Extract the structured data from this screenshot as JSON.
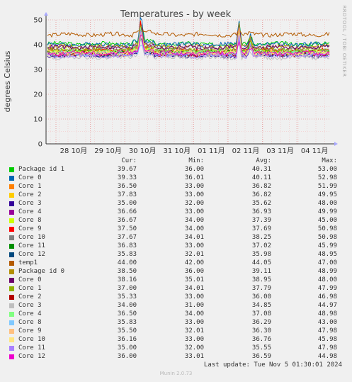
{
  "chart_data": {
    "type": "line",
    "title": "Temperatures - by week",
    "ylabel": "degrees Celsius",
    "side_label": "RRDTOOL / TOBI OETIKER",
    "ylim": [
      0,
      50
    ],
    "yticks": [
      0,
      10,
      20,
      30,
      40,
      50
    ],
    "xticks": [
      "28 10月",
      "29 10月",
      "30 10月",
      "31 10月",
      "01 11月",
      "02 11月",
      "03 11月",
      "04 11月"
    ],
    "grid": true,
    "columns": [
      "Cur:",
      "Min:",
      "Avg:",
      "Max:"
    ],
    "series": [
      {
        "name": "Package id 1",
        "color": "#00cc00",
        "cur": "39.67",
        "min": "36.00",
        "avg": "40.31",
        "max": "53.00"
      },
      {
        "name": "Core 0",
        "color": "#0066b3",
        "cur": "39.33",
        "min": "36.01",
        "avg": "40.11",
        "max": "52.98"
      },
      {
        "name": "Core 1",
        "color": "#ff8000",
        "cur": "36.50",
        "min": "33.00",
        "avg": "36.82",
        "max": "51.99"
      },
      {
        "name": "Core 2",
        "color": "#ffcc00",
        "cur": "37.83",
        "min": "33.00",
        "avg": "36.82",
        "max": "49.95"
      },
      {
        "name": "Core 3",
        "color": "#330099",
        "cur": "35.00",
        "min": "32.00",
        "avg": "35.62",
        "max": "48.00"
      },
      {
        "name": "Core 4",
        "color": "#990099",
        "cur": "36.66",
        "min": "33.00",
        "avg": "36.93",
        "max": "49.99"
      },
      {
        "name": "Core 8",
        "color": "#ccff00",
        "cur": "36.67",
        "min": "34.00",
        "avg": "37.39",
        "max": "45.00"
      },
      {
        "name": "Core 9",
        "color": "#ff0000",
        "cur": "37.50",
        "min": "34.00",
        "avg": "37.69",
        "max": "50.98"
      },
      {
        "name": "Core 10",
        "color": "#808080",
        "cur": "37.67",
        "min": "34.01",
        "avg": "38.25",
        "max": "50.98"
      },
      {
        "name": "Core 11",
        "color": "#008f00",
        "cur": "36.83",
        "min": "33.00",
        "avg": "37.02",
        "max": "45.99"
      },
      {
        "name": "Core 12",
        "color": "#00487d",
        "cur": "35.83",
        "min": "32.01",
        "avg": "35.98",
        "max": "48.95"
      },
      {
        "name": "temp1",
        "color": "#b35a00",
        "cur": "44.00",
        "min": "42.00",
        "avg": "44.05",
        "max": "47.00"
      },
      {
        "name": "Package id 0",
        "color": "#b38f00",
        "cur": "38.50",
        "min": "36.00",
        "avg": "39.11",
        "max": "48.99"
      },
      {
        "name": "Core 0",
        "color": "#6b006b",
        "cur": "38.16",
        "min": "35.01",
        "avg": "38.95",
        "max": "48.00"
      },
      {
        "name": "Core 1",
        "color": "#8fb300",
        "cur": "37.00",
        "min": "34.01",
        "avg": "37.79",
        "max": "47.99"
      },
      {
        "name": "Core 2",
        "color": "#b30000",
        "cur": "35.33",
        "min": "33.00",
        "avg": "36.00",
        "max": "46.98"
      },
      {
        "name": "Core 3",
        "color": "#bebebe",
        "cur": "34.00",
        "min": "31.00",
        "avg": "34.85",
        "max": "44.97"
      },
      {
        "name": "Core 4",
        "color": "#80ff80",
        "cur": "36.50",
        "min": "34.00",
        "avg": "37.08",
        "max": "48.98"
      },
      {
        "name": "Core 8",
        "color": "#80c9ff",
        "cur": "35.83",
        "min": "33.00",
        "avg": "36.29",
        "max": "43.00"
      },
      {
        "name": "Core 9",
        "color": "#ffc080",
        "cur": "35.50",
        "min": "32.01",
        "avg": "36.30",
        "max": "47.98"
      },
      {
        "name": "Core 10",
        "color": "#ffe680",
        "cur": "36.16",
        "min": "33.00",
        "avg": "36.76",
        "max": "45.98"
      },
      {
        "name": "Core 11",
        "color": "#aa80ff",
        "cur": "35.00",
        "min": "32.00",
        "avg": "35.55",
        "max": "47.98"
      },
      {
        "name": "Core 12",
        "color": "#ee00cc",
        "cur": "36.00",
        "min": "33.01",
        "avg": "36.59",
        "max": "44.98"
      }
    ]
  },
  "footer": {
    "last_update": "Last update: Tue Nov  5 01:30:01 2024",
    "generator": "Munin 2.0.73"
  }
}
